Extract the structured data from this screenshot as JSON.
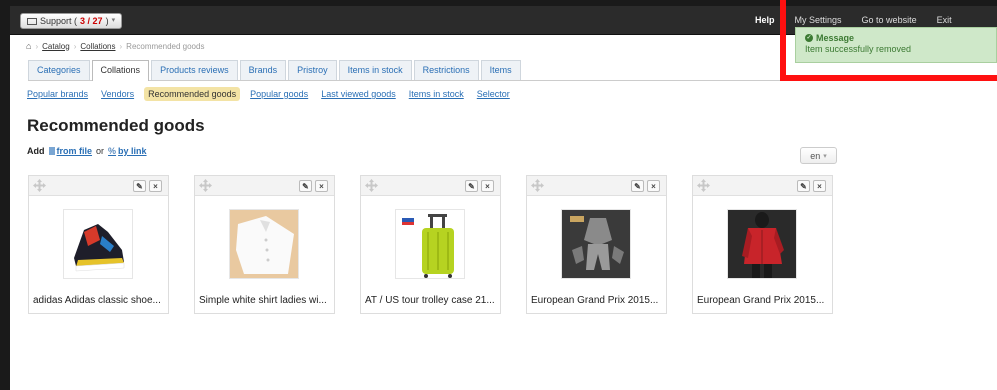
{
  "topbar": {
    "support_label": "Support (",
    "support_count": "3 / 27",
    "support_close": ")",
    "right_items": [
      "Help",
      "My Settings",
      "Go to website",
      "Exit"
    ]
  },
  "breadcrumb": {
    "items": [
      "Catalog",
      "Collations",
      "Recommended goods"
    ]
  },
  "tabs": [
    {
      "label": "Categories"
    },
    {
      "label": "Collations"
    },
    {
      "label": "Products reviews"
    },
    {
      "label": "Brands"
    },
    {
      "label": "Pristroy"
    },
    {
      "label": "Items in stock"
    },
    {
      "label": "Restrictions"
    },
    {
      "label": "Items"
    }
  ],
  "subnav": [
    {
      "label": "Popular brands"
    },
    {
      "label": "Vendors"
    },
    {
      "label": "Recommended goods"
    },
    {
      "label": "Popular goods"
    },
    {
      "label": "Last viewed goods"
    },
    {
      "label": "Items in stock"
    },
    {
      "label": "Selector"
    }
  ],
  "page": {
    "title": "Recommended goods",
    "add_label": "Add",
    "from_file": "from file",
    "or": "or",
    "by_link": "by link",
    "lang": "en"
  },
  "products": [
    {
      "title": "adidas Adidas classic shoe..."
    },
    {
      "title": "Simple white shirt ladies wi..."
    },
    {
      "title": "AT / US tour trolley case 21..."
    },
    {
      "title": "European Grand Prix 2015..."
    },
    {
      "title": "European Grand Prix 2015..."
    }
  ],
  "toast": {
    "title": "Message",
    "message": "Item successfully removed"
  },
  "colors": {
    "link": "#2a6fb5",
    "active_subnav": "#f3e3a5",
    "toast_bg": "#cfe8c9",
    "highlight": "#ff1010"
  }
}
